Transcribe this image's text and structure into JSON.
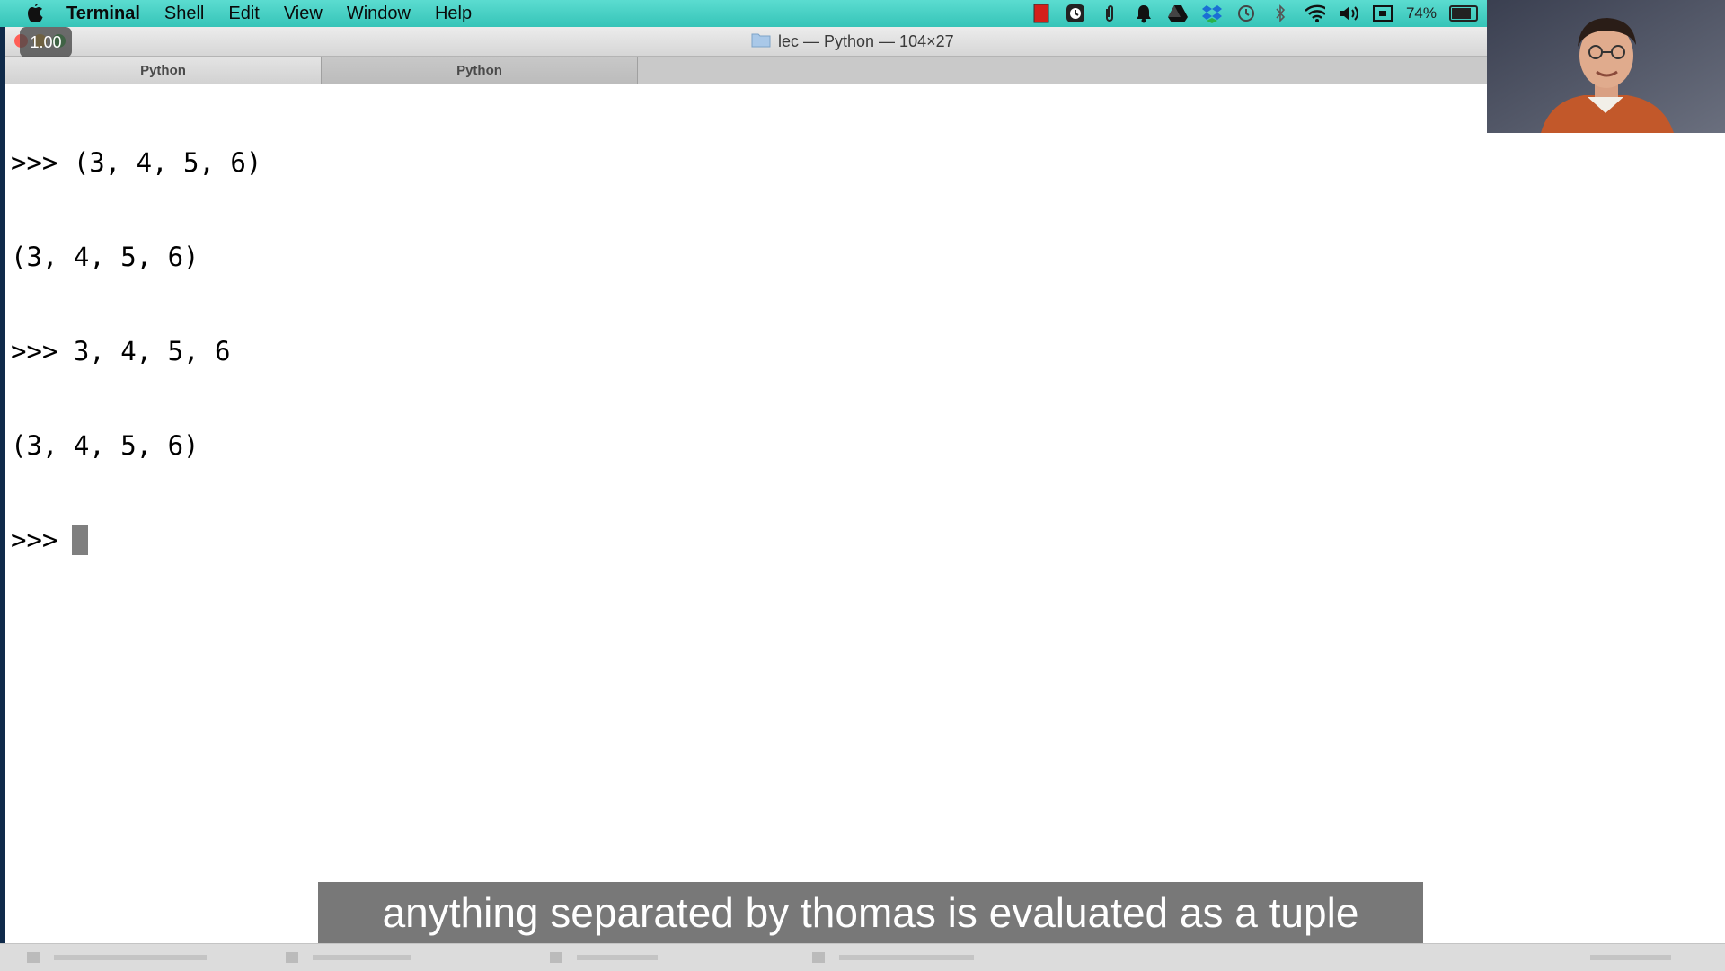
{
  "menubar": {
    "apple_icon": "apple-icon",
    "items": [
      "Terminal",
      "Shell",
      "Edit",
      "View",
      "Window",
      "Help"
    ],
    "status_icons": [
      "red-square-icon",
      "clock-app-icon",
      "paperclip-icon",
      "bell-icon",
      "drive-icon",
      "dropbox-icon",
      "time-machine-icon",
      "bluetooth-icon",
      "wifi-icon",
      "volume-icon",
      "display-icon"
    ],
    "battery_percent": "74%",
    "battery_level": 0.74
  },
  "window": {
    "speed_badge": "1.00",
    "title": "lec — Python — 104×27",
    "tabs": [
      {
        "label": "Python",
        "active": true
      },
      {
        "label": "Python",
        "active": false
      }
    ],
    "console_lines": [
      ">>> (3, 4, 5, 6)",
      "(3, 4, 5, 6)",
      ">>> 3, 4, 5, 6",
      "(3, 4, 5, 6)"
    ],
    "prompt": ">>>"
  },
  "subtitle": "anything separated by thomas is evaluated as a tuple",
  "colors": {
    "menubar": "#44d0c4",
    "subtitle_bg": "#5a5a5a",
    "close": "#ff5f57",
    "minimize": "#ffbd2e",
    "zoom": "#28c940"
  }
}
